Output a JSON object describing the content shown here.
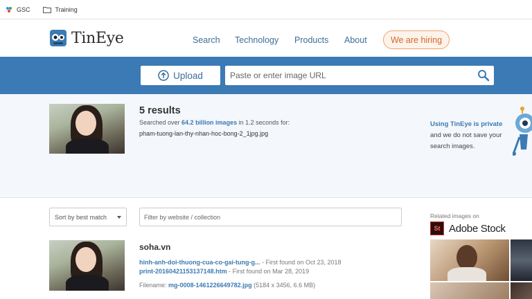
{
  "bookmarks": [
    {
      "label": "GSC",
      "icon": "gsc-icon"
    },
    {
      "label": "Training",
      "icon": "folder-icon"
    }
  ],
  "brand": {
    "name": "TinEye",
    "accent": "#3b7ab4",
    "hiring_color": "#d8652a"
  },
  "nav": {
    "search": "Search",
    "technology": "Technology",
    "products": "Products",
    "about": "About",
    "hiring": "We are hiring"
  },
  "search": {
    "upload_label": "Upload",
    "url_placeholder": "Paste or enter image URL"
  },
  "summary": {
    "count": "5 results",
    "searched_prefix": "Searched over ",
    "searched_count": "64.2 billion images",
    "searched_suffix": " in 1.2 seconds for:",
    "filename": "pham-tuong-lan-thy-nhan-hoc-bong-2_1jpg.jpg",
    "privacy_link": "Using TinEye is private",
    "privacy_line2": "and we do not save your",
    "privacy_line3": "search images."
  },
  "controls": {
    "sort_value": "Sort by best match",
    "filter_placeholder": "Filter by website / collection"
  },
  "result": {
    "site": "soha.vn",
    "link1": "hinh-anh-doi-thuong-cua-co-gai-tung-g...",
    "found1": " - First found on Oct 23, 2018",
    "link2": "print-20160421153137148.htm",
    "found2": " - First found on Mar 28, 2019",
    "file_prefix": "Filename: ",
    "file_link": "mg-0008-1461226649782.jpg",
    "file_meta": " (5184 x 3456, 6.6 MB)"
  },
  "sidebar": {
    "related_label": "Related images on",
    "stock_badge": "St",
    "stock_name": "Adobe Stock"
  }
}
